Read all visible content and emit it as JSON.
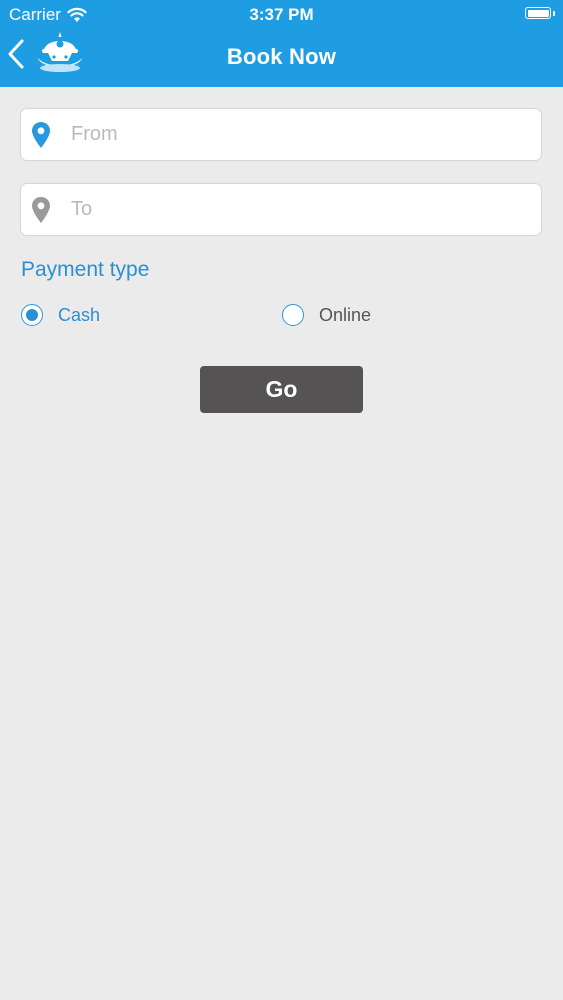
{
  "status_bar": {
    "carrier": "Carrier",
    "time": "3:37 PM",
    "wifi_icon": "wifi-icon",
    "battery_icon": "battery-icon"
  },
  "nav": {
    "title": "Book Now",
    "back_icon": "chevron-left-icon",
    "logo_icon": "app-logo"
  },
  "form": {
    "from": {
      "placeholder": "From",
      "value": "",
      "icon": "location-pin-icon",
      "icon_color": "#2a98de"
    },
    "to": {
      "placeholder": "To",
      "value": "",
      "icon": "location-pin-icon",
      "icon_color": "#9a9a9a"
    },
    "payment_label": "Payment type",
    "payment_options": [
      {
        "label": "Cash",
        "selected": true
      },
      {
        "label": "Online",
        "selected": false
      }
    ],
    "go_label": "Go"
  },
  "colors": {
    "header_blue": "#1e9de2",
    "accent_blue": "#2a8fd3",
    "background": "#ebebeb",
    "button_dark": "#555354"
  }
}
